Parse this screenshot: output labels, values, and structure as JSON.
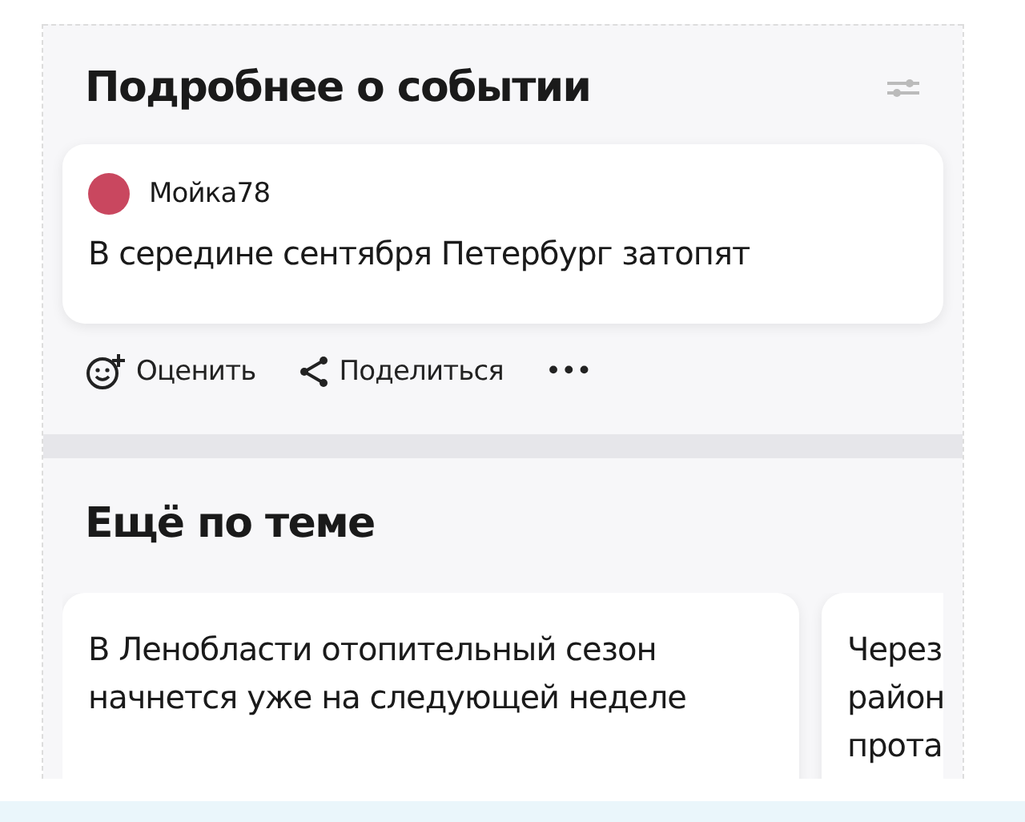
{
  "event": {
    "title": "Подробнее о событии",
    "source": {
      "name": "Мойка78",
      "headline": "В середине сентября Петербург затопят"
    },
    "actions": [
      {
        "kind": "rate",
        "label": "Оценить"
      },
      {
        "kind": "share",
        "label": "Поделиться"
      },
      {
        "kind": "more",
        "label": "•••"
      }
    ]
  },
  "related": {
    "title": "Ещё по теме",
    "cards": [
      {
        "lines": [
          "В Ленобласти отопительный сезон",
          "начнется уже на следующей неделе"
        ]
      },
      {
        "lines": [
          "Через",
          "район",
          "прота"
        ]
      }
    ]
  }
}
